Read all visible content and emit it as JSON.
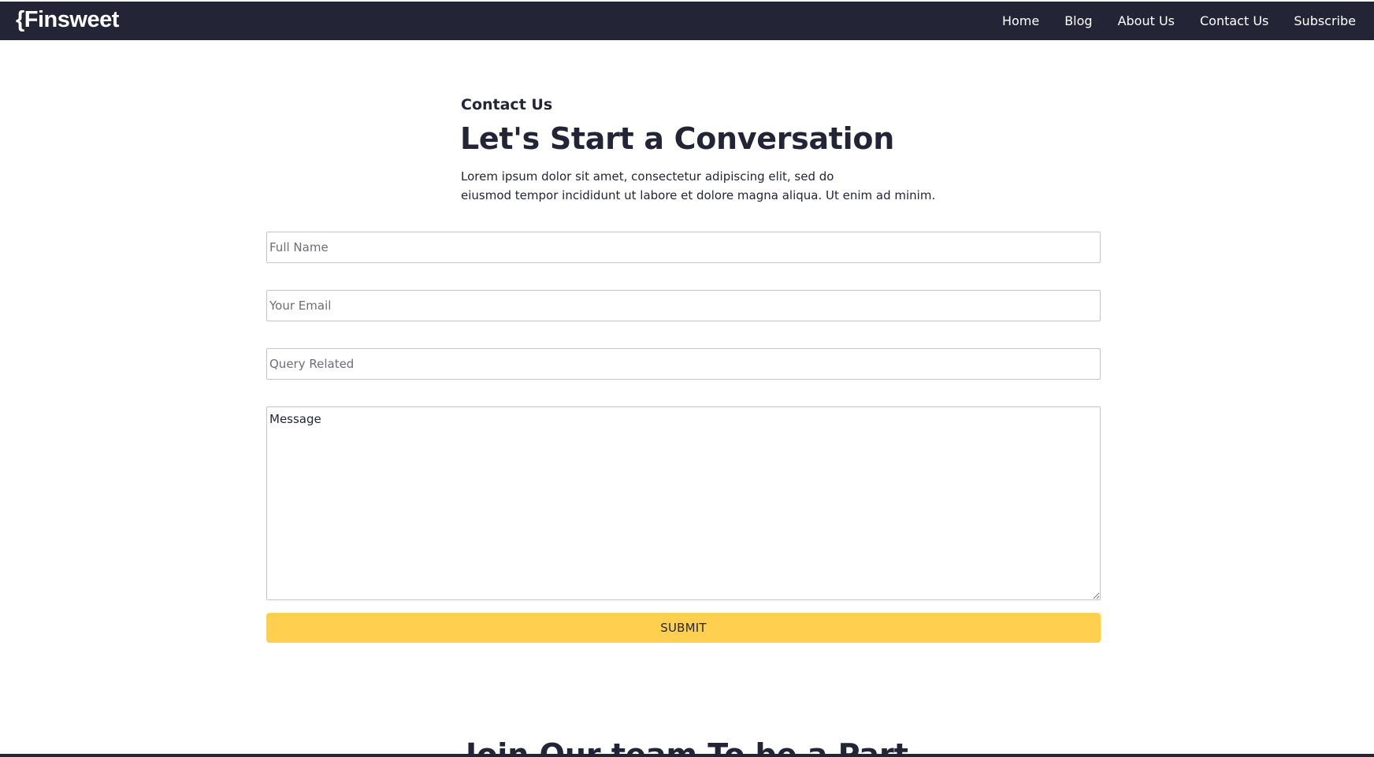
{
  "navbar": {
    "brand": "{Finsweet",
    "links": [
      {
        "label": "Home"
      },
      {
        "label": "Blog"
      },
      {
        "label": "About Us"
      },
      {
        "label": "Contact Us"
      },
      {
        "label": "Subscribe"
      }
    ]
  },
  "contact": {
    "eyebrow": "Contact Us",
    "headline": "Let's Start a Conversation",
    "lead_line_1": "Lorem ipsum dolor sit amet, consectetur adipiscing elit, sed do",
    "lead_line_2": "eiusmod tempor incididunt ut labore et dolore magna aliqua. Ut enim ad minim."
  },
  "form": {
    "full_name": {
      "placeholder": "Full Name",
      "value": ""
    },
    "email": {
      "placeholder": "Your Email",
      "value": ""
    },
    "query": {
      "placeholder": "Query Related",
      "value": ""
    },
    "message": {
      "placeholder": "Message",
      "value": ""
    },
    "submit_label": "SUBMIT"
  },
  "next_section": {
    "heading": "Join Our team To be a Part"
  },
  "colors": {
    "navbar_bg": "#232536",
    "accent": "#FFD050",
    "text": "#232536"
  }
}
